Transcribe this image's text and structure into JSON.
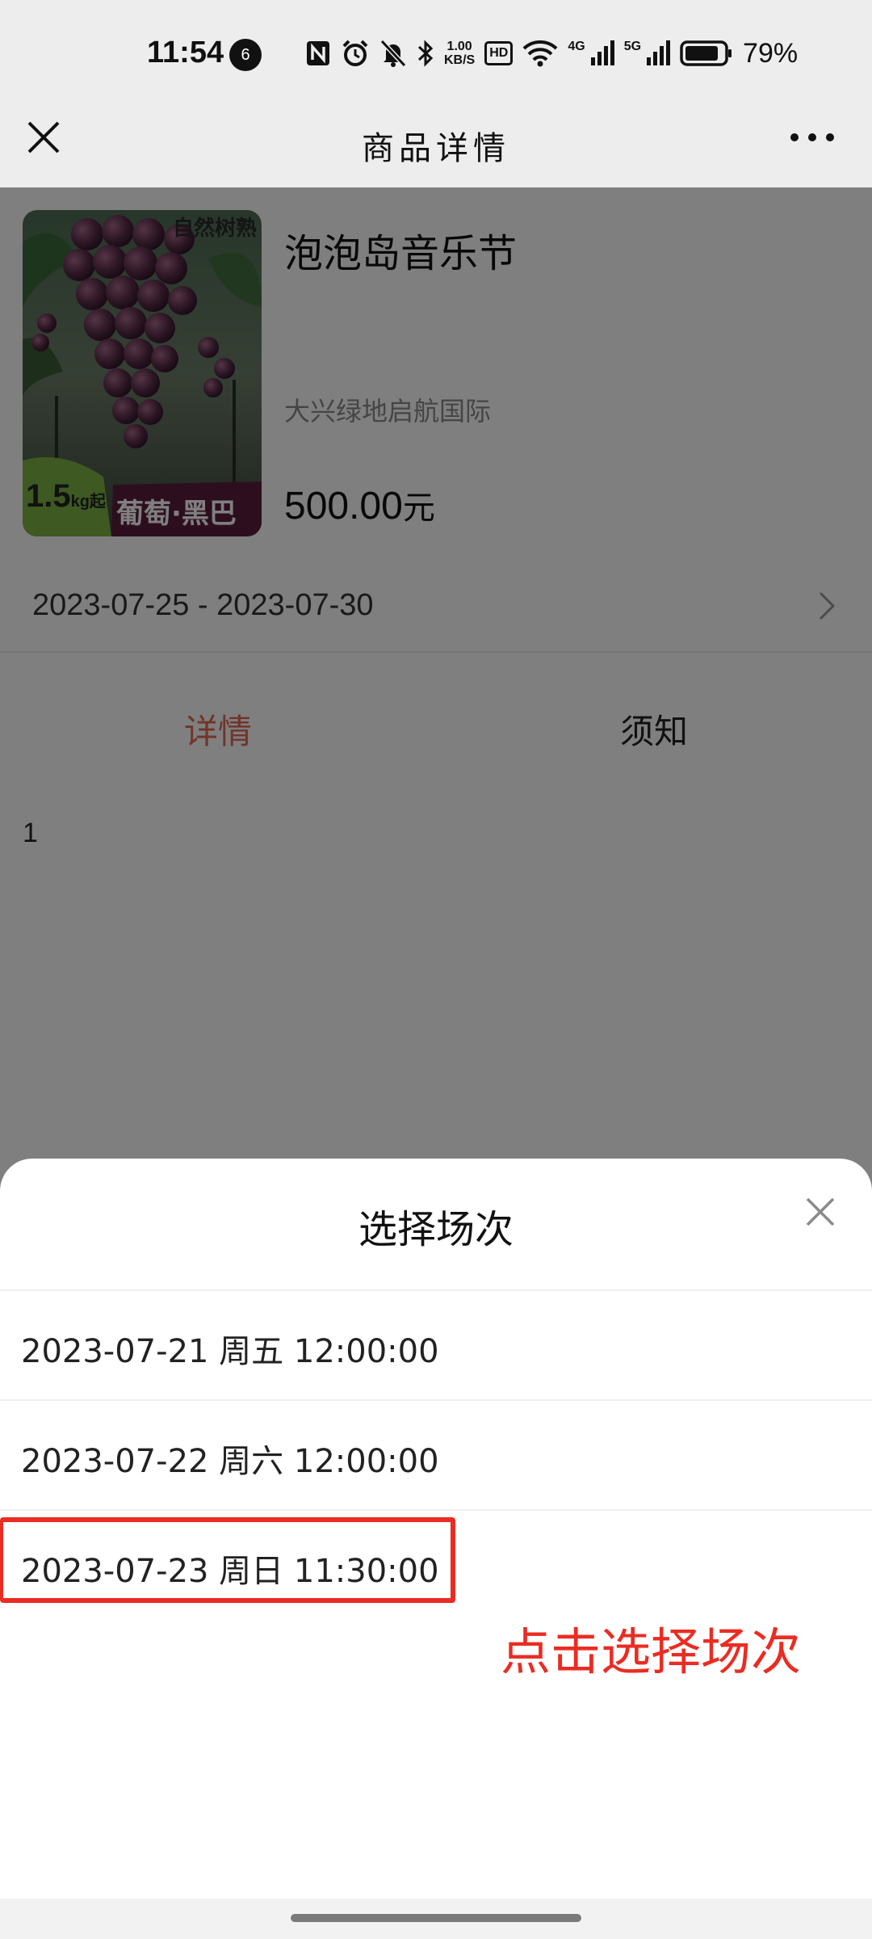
{
  "status_bar": {
    "time": "11:54",
    "notification_count": "6",
    "net_speed_value": "1.00",
    "net_speed_unit": "KB/S",
    "hd_label": "HD",
    "signal_1_label": "4G",
    "signal_2_label": "5G",
    "battery_percent": "79%"
  },
  "nav": {
    "title": "商品详情"
  },
  "product": {
    "image_badge_top": "自然树熟",
    "image_weight": "1.5",
    "image_weight_unit": "kg起",
    "image_label": "葡萄·黑巴拉蒂",
    "name": "泡泡岛音乐节",
    "venue": "大兴绿地启航国际",
    "price": "500.00",
    "price_unit": "元",
    "date_range": "2023-07-25 - 2023-07-30"
  },
  "tabs": [
    {
      "label": "详情",
      "active": true
    },
    {
      "label": "须知",
      "active": false
    }
  ],
  "detail_content": "1",
  "sheet": {
    "title": "选择场次",
    "sessions": [
      {
        "label": "2023-07-21 周五 12:00:00"
      },
      {
        "label": "2023-07-22 周六 12:00:00"
      },
      {
        "label": "2023-07-23 周日 11:30:00"
      }
    ],
    "annotation": "点击选择场次"
  },
  "colors": {
    "accent_tab": "#e06a55",
    "annotation_red": "#ea2c23",
    "overlay": "rgba(0,0,0,0.5)"
  },
  "icons": [
    "close-icon",
    "more-icon",
    "chevron-right-icon",
    "nfc-icon",
    "alarm-icon",
    "mute-icon",
    "bluetooth-icon",
    "wifi-icon",
    "signal-icon",
    "battery-icon"
  ]
}
